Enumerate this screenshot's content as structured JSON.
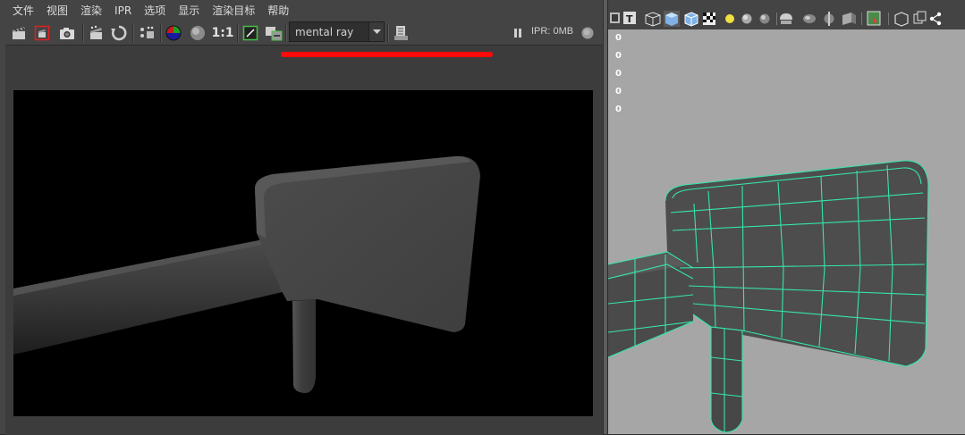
{
  "render_view": {
    "menu": [
      "文件",
      "视图",
      "渲染",
      "IPR",
      "选项",
      "显示",
      "渲染目标",
      "帮助"
    ],
    "toolbar": {
      "ratio_label": "1:1",
      "renderer": "mental ray",
      "ipr_status": "IPR: 0MB"
    },
    "colors": {
      "annotation_line": "#ff0a0a",
      "render_background": "#000000"
    }
  },
  "viewport": {
    "hud_values": [
      "0",
      "0",
      "0",
      "0",
      "0"
    ],
    "colors": {
      "background": "#a6a6a6",
      "wireframe": "#35e6a8",
      "mesh": "#4a4a4a"
    }
  }
}
